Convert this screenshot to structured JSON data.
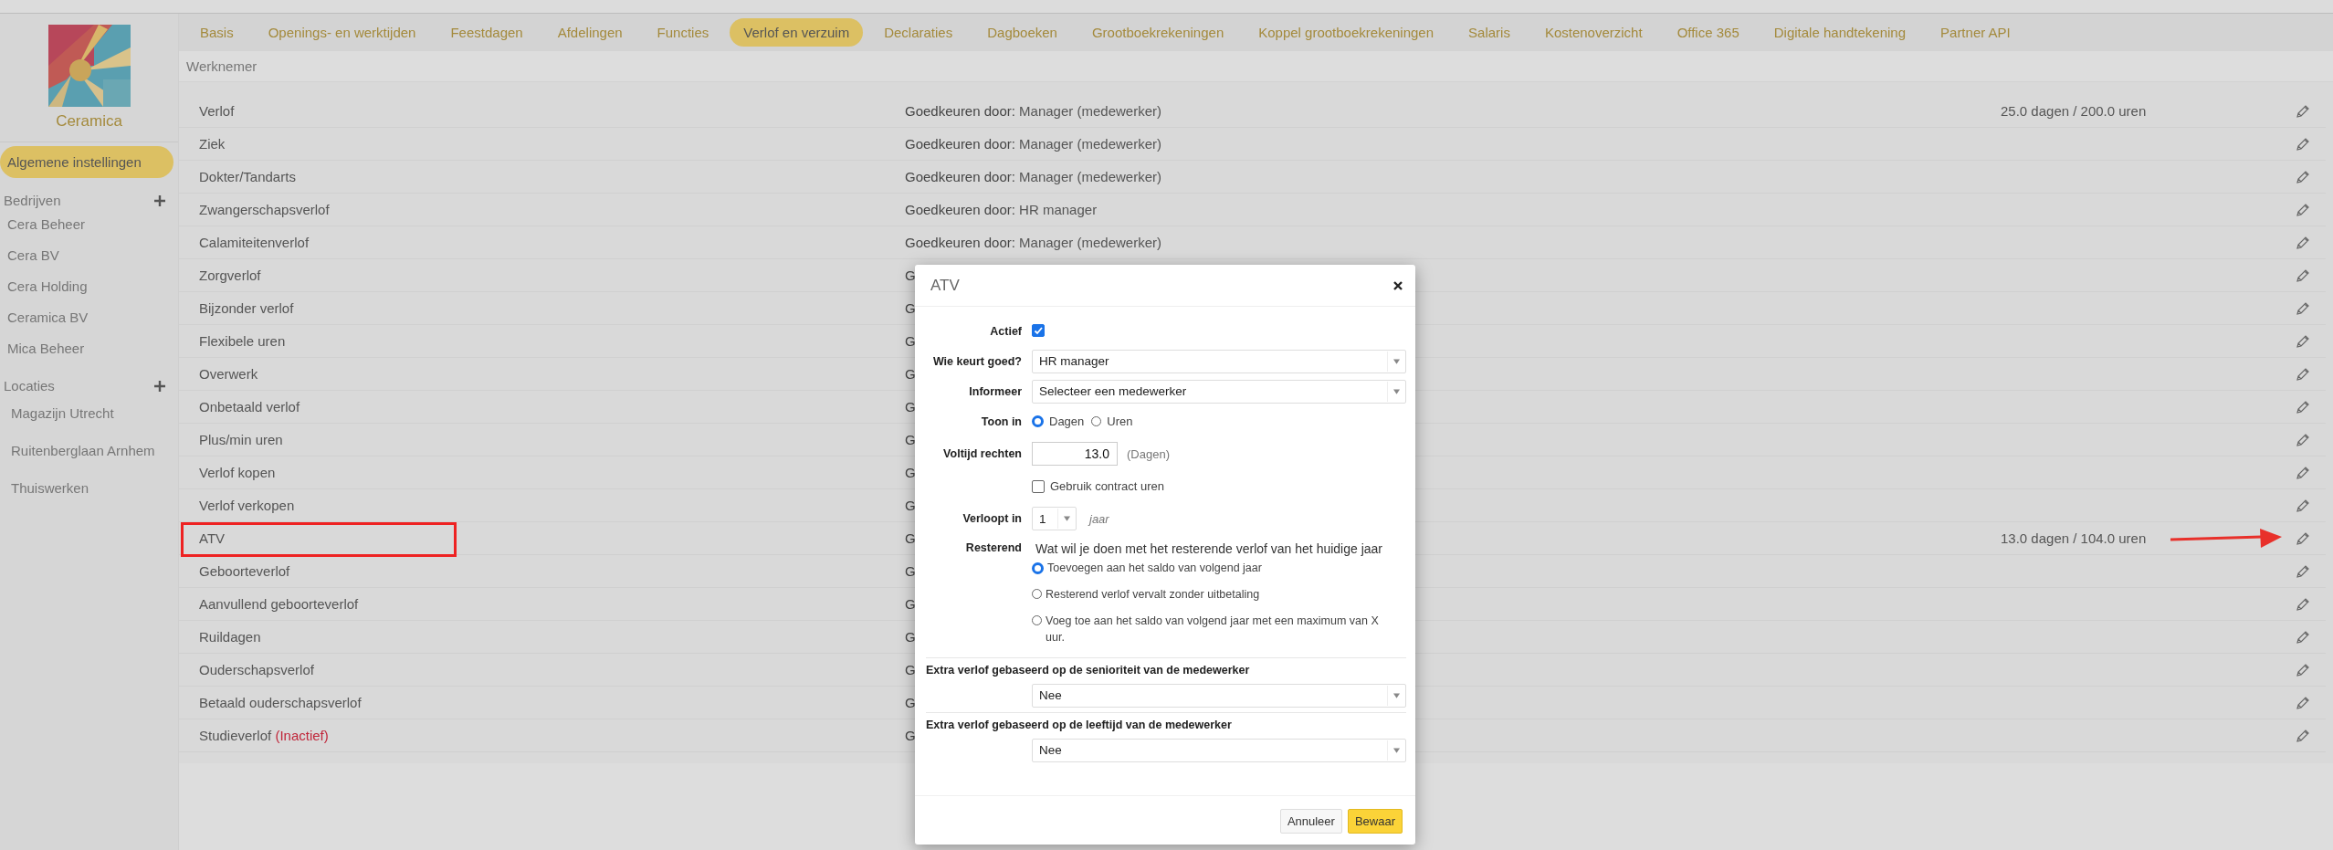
{
  "company": {
    "name": "Ceramica"
  },
  "sidebar": {
    "main_item": {
      "label": "Algemene instellingen",
      "selected": true
    },
    "sections": [
      {
        "title": "Bedrijven",
        "items": [
          "Cera Beheer",
          "Cera BV",
          "Cera Holding",
          "Ceramica BV",
          "Mica Beheer"
        ]
      },
      {
        "title": "Locaties",
        "items": [
          "Magazijn Utrecht",
          "Ruitenberglaan Arnhem",
          "Thuiswerken"
        ]
      }
    ]
  },
  "tabs": [
    {
      "label": "Basis",
      "selected": false
    },
    {
      "label": "Openings- en werktijden",
      "selected": false
    },
    {
      "label": "Feestdagen",
      "selected": false
    },
    {
      "label": "Afdelingen",
      "selected": false
    },
    {
      "label": "Functies",
      "selected": false
    },
    {
      "label": "Verlof en verzuim",
      "selected": true
    },
    {
      "label": "Declaraties",
      "selected": false
    },
    {
      "label": "Dagboeken",
      "selected": false
    },
    {
      "label": "Grootboekrekeningen",
      "selected": false
    },
    {
      "label": "Koppel grootboekrekeningen",
      "selected": false
    },
    {
      "label": "Salaris",
      "selected": false
    },
    {
      "label": "Kostenoverzicht",
      "selected": false
    },
    {
      "label": "Office 365",
      "selected": false
    },
    {
      "label": "Digitale handtekening",
      "selected": false
    },
    {
      "label": "Partner API",
      "selected": false
    }
  ],
  "section_title": "Werknemer",
  "rows": [
    {
      "name": "Verlof",
      "approval_label": "Goedkeuren door:",
      "approval_value": "Manager (medewerker)",
      "balance": "25.0 dagen / 200.0 uren",
      "highlighted": false,
      "arrow": false
    },
    {
      "name": "Ziek",
      "approval_label": "Goedkeuren door:",
      "approval_value": "Manager (medewerker)",
      "highlighted": false,
      "arrow": false
    },
    {
      "name": "Dokter/Tandarts",
      "approval_label": "Goedkeuren door:",
      "approval_value": "Manager (medewerker)",
      "highlighted": false,
      "arrow": false
    },
    {
      "name": "Zwangerschapsverlof",
      "approval_label": "Goedkeuren door:",
      "approval_value": "HR manager",
      "highlighted": false,
      "arrow": false
    },
    {
      "name": "Calamiteitenverlof",
      "approval_label": "Goedkeuren door:",
      "approval_value": "Manager (medewerker)",
      "highlighted": false,
      "arrow": false
    },
    {
      "name": "Zorgverlof",
      "approval_label": "G",
      "highlighted": false,
      "arrow": false
    },
    {
      "name": "Bijzonder verlof",
      "approval_label": "G",
      "highlighted": false,
      "arrow": false
    },
    {
      "name": "Flexibele uren",
      "approval_label": "G",
      "highlighted": false,
      "arrow": false
    },
    {
      "name": "Overwerk",
      "approval_label": "G",
      "highlighted": false,
      "arrow": false
    },
    {
      "name": "Onbetaald verlof",
      "approval_label": "G",
      "highlighted": false,
      "arrow": false
    },
    {
      "name": "Plus/min uren",
      "approval_label": "G",
      "highlighted": false,
      "arrow": false
    },
    {
      "name": "Verlof kopen",
      "approval_label": "G",
      "highlighted": false,
      "arrow": false
    },
    {
      "name": "Verlof verkopen",
      "approval_label": "G",
      "highlighted": false,
      "arrow": false
    },
    {
      "name": "ATV",
      "approval_label": "G",
      "balance": "13.0 dagen / 104.0 uren",
      "highlighted": true,
      "arrow": true
    },
    {
      "name": "Geboorteverlof",
      "approval_label": "G",
      "highlighted": false,
      "arrow": false
    },
    {
      "name": "Aanvullend geboorteverlof",
      "approval_label": "G",
      "highlighted": false,
      "arrow": false
    },
    {
      "name": "Ruildagen",
      "approval_label": "G",
      "highlighted": false,
      "arrow": false
    },
    {
      "name": "Ouderschapsverlof",
      "approval_label": "G",
      "highlighted": false,
      "arrow": false
    },
    {
      "name": "Betaald ouderschapsverlof",
      "approval_label": "G",
      "highlighted": false,
      "arrow": false
    },
    {
      "name": "Studieverlof",
      "inactive_note": "(Inactief)",
      "approval_label": "G",
      "highlighted": false,
      "arrow": false
    }
  ],
  "modal": {
    "title": "ATV",
    "fields": [
      {
        "kind": "checkbox",
        "label": "Actief",
        "checked": true
      },
      {
        "kind": "select",
        "label": "Wie keurt goed?",
        "value": "HR manager"
      },
      {
        "kind": "select",
        "label": "Informeer",
        "value": "Selecteer een medewerker"
      },
      {
        "kind": "radios",
        "label": "Toon in",
        "options": [
          {
            "label": "Dagen",
            "selected": true
          },
          {
            "label": "Uren",
            "selected": false
          }
        ]
      },
      {
        "kind": "number",
        "label": "Voltijd rechten",
        "value": "13.0",
        "unit": "(Dagen)"
      },
      {
        "kind": "check_option",
        "text": "Gebruik contract uren",
        "checked": false
      },
      {
        "kind": "small_select",
        "label": "Verloopt in",
        "value": "1",
        "unit": "jaar"
      },
      {
        "kind": "radio_list",
        "label": "Resterend",
        "question": "Wat wil je doen met het resterende verlof van het huidige jaar",
        "options": [
          {
            "label": "Toevoegen aan het saldo van volgend jaar",
            "selected": true
          },
          {
            "label": "Resterend verlof vervalt zonder uitbetaling",
            "selected": false
          },
          {
            "label": "Voeg toe aan het saldo van volgend jaar met een maximum van X uur.",
            "selected": false
          }
        ]
      },
      {
        "kind": "section_select",
        "heading": "Extra verlof gebaseerd op de senioriteit van de medewerker",
        "value": "Nee"
      },
      {
        "kind": "section_select",
        "heading": "Extra verlof gebaseerd op de leeftijd van de medewerker",
        "value": "Nee"
      }
    ],
    "buttons": [
      {
        "label": "Annuleer",
        "primary": false
      },
      {
        "label": "Bewaar",
        "primary": true
      }
    ]
  }
}
